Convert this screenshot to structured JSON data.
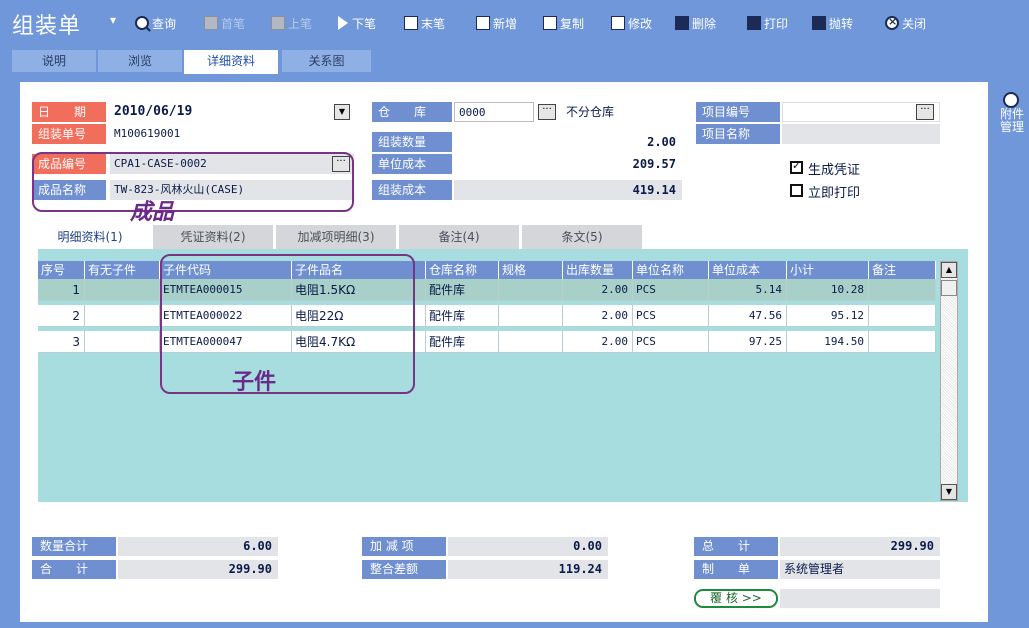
{
  "toolbar": {
    "title": "组装单",
    "buttons": [
      {
        "label": "查询",
        "icon": "search-icon",
        "enabled": true
      },
      {
        "label": "首笔",
        "icon": "first-record-icon",
        "enabled": false
      },
      {
        "label": "上笔",
        "icon": "prev-record-icon",
        "enabled": false
      },
      {
        "label": "下笔",
        "icon": "next-record-icon",
        "enabled": true
      },
      {
        "label": "末笔",
        "icon": "last-record-icon",
        "enabled": true
      },
      {
        "label": "新增",
        "icon": "new-icon",
        "enabled": true
      },
      {
        "label": "复制",
        "icon": "copy-icon",
        "enabled": true
      },
      {
        "label": "修改",
        "icon": "edit-icon",
        "enabled": true
      },
      {
        "label": "删除",
        "icon": "delete-icon",
        "enabled": true
      },
      {
        "label": "打印",
        "icon": "print-icon",
        "enabled": true
      },
      {
        "label": "抛转",
        "icon": "transfer-icon",
        "enabled": true
      },
      {
        "label": "关闭",
        "icon": "close-icon",
        "enabled": true
      }
    ]
  },
  "top_tabs": [
    "说明",
    "浏览",
    "详细资料",
    "关系图"
  ],
  "sidebar": {
    "label": "附件管理",
    "icon": "attachment-search-icon"
  },
  "header": {
    "date_label": "日　　期",
    "date_value": "2010/06/19",
    "assembly_no_label": "组装单号",
    "assembly_no_value": "M100619001",
    "product_code_label": "成品编号",
    "product_code_value": "CPA1-CASE-0002",
    "product_name_label": "成品名称",
    "product_name_value": "TW-823-风林火山(CASE)",
    "warehouse_label": "仓　　库",
    "warehouse_code": "0000",
    "warehouse_name": "不分仓库",
    "qty_label": "组装数量",
    "qty_value": "2.00",
    "unit_cost_label": "单位成本",
    "unit_cost_value": "209.57",
    "assembly_cost_label": "组装成本",
    "assembly_cost_value": "419.14",
    "project_no_label": "项目编号",
    "project_no_value": "",
    "project_name_label": "项目名称",
    "project_name_value": "",
    "gen_voucher_label": "生成凭证",
    "gen_voucher_checked": true,
    "print_now_label": "立即打印",
    "print_now_checked": false
  },
  "annotations": {
    "product": "成品",
    "component": "子件"
  },
  "sub_tabs": [
    "明细资料(1)",
    "凭证资料(2)",
    "加减项明细(3)",
    "备注(4)",
    "条文(5)"
  ],
  "grid": {
    "columns": [
      "序号",
      "有无子件",
      "子件代码",
      "子件品名",
      "仓库名称",
      "规格",
      "出库数量",
      "单位名称",
      "单位成本",
      "小计",
      "备注"
    ],
    "rows": [
      {
        "seq": "1",
        "has_sub": "",
        "code": "ETMTEA000015",
        "name": "电阻1.5KΩ",
        "warehouse": "配件库",
        "spec": "",
        "qty": "2.00",
        "unit": "PCS",
        "unit_cost": "5.14",
        "subtotal": "10.28",
        "note": ""
      },
      {
        "seq": "2",
        "has_sub": "",
        "code": "ETMTEA000022",
        "name": "电阻22Ω",
        "warehouse": "配件库",
        "spec": "",
        "qty": "2.00",
        "unit": "PCS",
        "unit_cost": "47.56",
        "subtotal": "95.12",
        "note": ""
      },
      {
        "seq": "3",
        "has_sub": "",
        "code": "ETMTEA000047",
        "name": "电阻4.7KΩ",
        "warehouse": "配件库",
        "spec": "",
        "qty": "2.00",
        "unit": "PCS",
        "unit_cost": "97.25",
        "subtotal": "194.50",
        "note": ""
      }
    ]
  },
  "footer": {
    "qty_total_label": "数量合计",
    "qty_total_value": "6.00",
    "sum_label": "合　　计",
    "sum_value": "299.90",
    "addsub_label": "加 减 项",
    "addsub_value": "0.00",
    "round_diff_label": "整合差额",
    "round_diff_value": "119.24",
    "grand_total_label": "总　　计",
    "grand_total_value": "299.90",
    "maker_label": "制　　单",
    "maker_value": "系统管理者",
    "audit_button": "覆 核 >>"
  },
  "colors": {
    "toolbar_bg": "#6f97d9",
    "label_red": "#f06e5b",
    "label_blue": "#6f8fd0",
    "grid_bg": "#a8dde0",
    "annotation": "#7a3486"
  }
}
